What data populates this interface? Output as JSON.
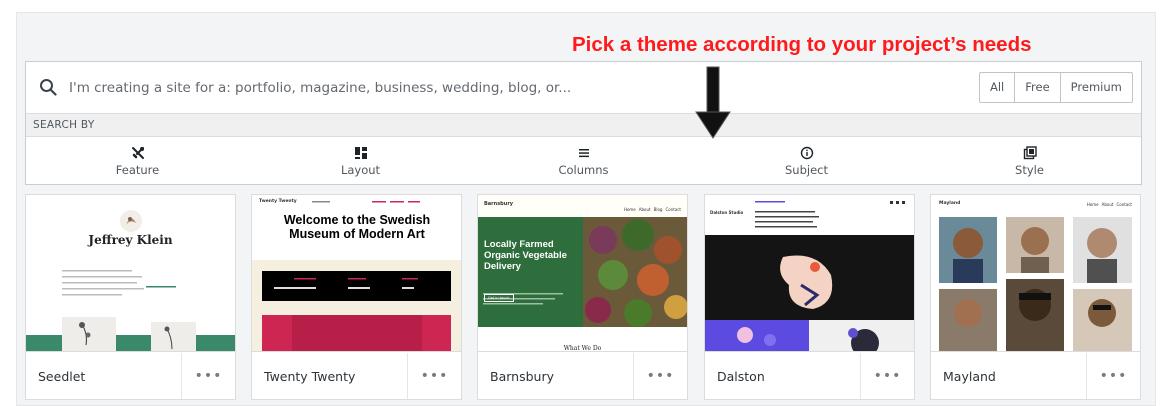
{
  "annotation": "Pick a theme according to your project’s needs",
  "search": {
    "placeholder": "I'm creating a site for a: portfolio, magazine, business, wedding, blog, or..."
  },
  "filters": [
    "All",
    "Free",
    "Premium"
  ],
  "search_by_label": "SEARCH BY",
  "categories": [
    {
      "label": "Feature",
      "icon": "tools-icon"
    },
    {
      "label": "Layout",
      "icon": "layout-icon"
    },
    {
      "label": "Columns",
      "icon": "columns-icon"
    },
    {
      "label": "Subject",
      "icon": "info-icon"
    },
    {
      "label": "Style",
      "icon": "style-icon"
    }
  ],
  "themes": [
    {
      "name": "Seedlet",
      "preview": {
        "site_title": "Jeffrey Klein",
        "accent": "#3a8a6a"
      }
    },
    {
      "name": "Twenty Twenty",
      "preview": {
        "site_title": "Twenty Twenty",
        "heading": "Welcome to the Swedish Museum of Modern Art",
        "accent": "#cd2653"
      }
    },
    {
      "name": "Barnsbury",
      "preview": {
        "site_title": "Barnsbury",
        "nav": [
          "Home",
          "About",
          "Blog",
          "Contact"
        ],
        "heading": "Locally Farmed Organic Vegetable Delivery",
        "button": "Get in touch",
        "subheading": "What We Do",
        "accent": "#2e6d3c"
      }
    },
    {
      "name": "Dalston",
      "preview": {
        "site_title": "Dalston Studio",
        "accent": "#5b4be0"
      }
    },
    {
      "name": "Mayland",
      "preview": {
        "site_title": "Mayland",
        "nav": [
          "Home",
          "About",
          "Contact"
        ]
      }
    }
  ],
  "more_label": "•••"
}
